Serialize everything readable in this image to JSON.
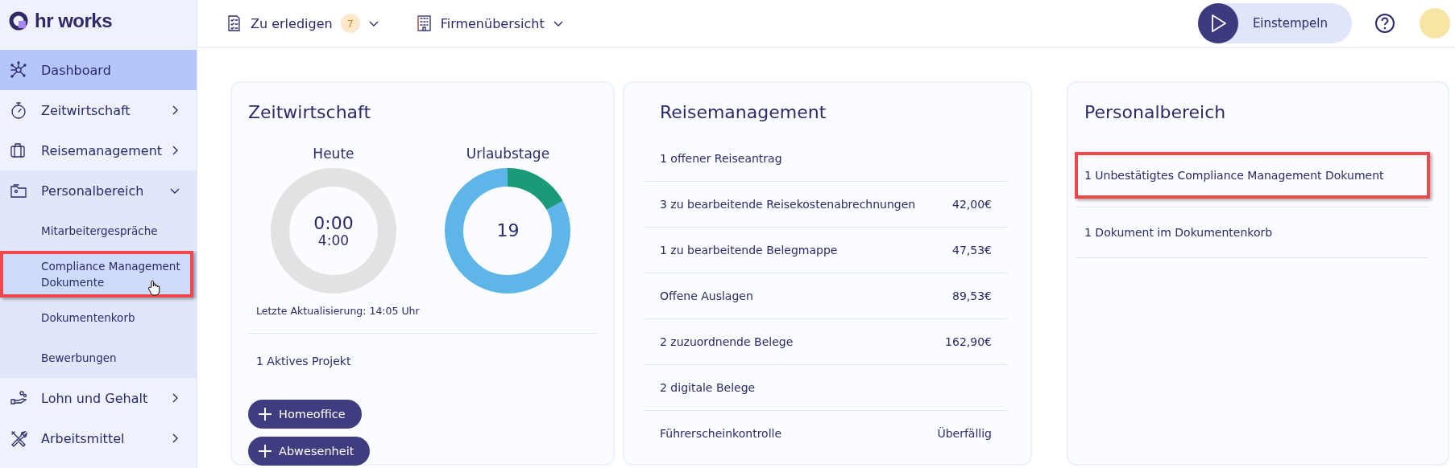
{
  "logo": {
    "text": "hr works"
  },
  "topbar": {
    "menus": [
      {
        "label": "Zu erledigen",
        "badge": "7"
      },
      {
        "label": "Firmenübersicht"
      }
    ],
    "clock_button": {
      "label": "Einstempeln"
    }
  },
  "sidebar": {
    "items": [
      {
        "label": "Dashboard",
        "kind": "link",
        "selected": true
      },
      {
        "label": "Zeitwirtschaft",
        "kind": "group",
        "selected": false,
        "expanded": false
      },
      {
        "label": "Reisemanagement",
        "kind": "group",
        "selected": false,
        "expanded": false
      },
      {
        "label": "Personalbereich",
        "kind": "group",
        "selected": false,
        "expanded": true,
        "children": [
          {
            "label": "Mitarbeitergespräche",
            "hovered": false,
            "highlighted": false
          },
          {
            "label": "Compliance Management Dokumente",
            "hovered": true,
            "highlighted": true
          },
          {
            "label": "Dokumentenkorb",
            "hovered": false,
            "highlighted": false
          },
          {
            "label": "Bewerbungen",
            "hovered": false,
            "highlighted": false
          }
        ]
      },
      {
        "label": "Lohn und Gehalt",
        "kind": "group",
        "selected": false,
        "expanded": false
      },
      {
        "label": "Arbeitsmittel",
        "kind": "group",
        "selected": false,
        "expanded": false
      }
    ]
  },
  "cards": [
    {
      "title": "Zeitwirtschaft",
      "kind": "time",
      "gauges": [
        {
          "label": "Heute",
          "kind": "hours",
          "values": [
            "0:00",
            "4:00"
          ]
        },
        {
          "label": "Urlaubstage",
          "kind": "days",
          "values": [
            "19"
          ]
        }
      ],
      "updated": "Letzte Aktualisierung: 14:05 Uhr",
      "project": "1 Aktives Projekt",
      "buttons": [
        "Homeoffice",
        "Abwesenheit"
      ]
    },
    {
      "title": "Reisemanagement",
      "kind": "list",
      "rows": [
        {
          "label": "1 offener Reiseantrag",
          "highlighted": false
        },
        {
          "label": "3 zu bearbeitende Reisekostenabrechnungen",
          "amount": "42,00€",
          "highlighted": false
        },
        {
          "label": "1 zu bearbeitende Belegmappe",
          "amount": "47,53€",
          "highlighted": false
        },
        {
          "label": "Offene Auslagen",
          "amount": "89,53€",
          "highlighted": false
        },
        {
          "label": "2 zuzuordnende Belege",
          "amount": "162,90€",
          "highlighted": false
        },
        {
          "label": "2 digitale Belege",
          "highlighted": false
        },
        {
          "label": "Führerscheinkontrolle",
          "amount": "Überfällig",
          "highlighted": false
        }
      ]
    },
    {
      "title": "Personalbereich",
      "kind": "list",
      "rows": [
        {
          "label": "1 Unbestätigtes Compliance Management Dokument",
          "highlighted": true
        },
        {
          "label": "1 Dokument im Dokumentenkorb",
          "highlighted": false
        }
      ]
    }
  ]
}
